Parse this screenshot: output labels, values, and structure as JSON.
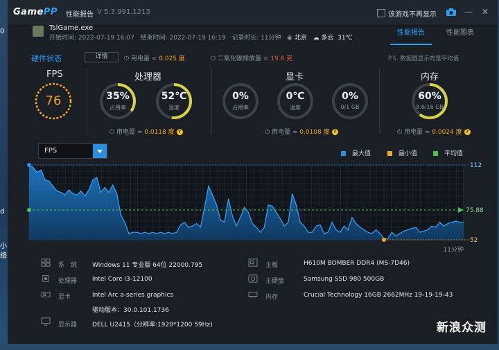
{
  "app": {
    "logo_prefix": "Game",
    "logo_suffix": "PP",
    "title": "性能报告",
    "version": "V 5.3.991.1213",
    "no_show_label": "该游戏不再显示"
  },
  "desktop": {
    "left_chars": [
      "0",
      "d",
      "小",
      "络"
    ]
  },
  "session": {
    "game": "TslGame.exe",
    "start": "开始时间: 2022-07-19 16:07",
    "end": "结束时间: 2022-07-19 16:19",
    "duration": "记录时长: 11分钟",
    "city": "北京",
    "weather": "多云",
    "temp": "31℃"
  },
  "tabs": [
    "性能报告",
    "性能图表"
  ],
  "hardware": {
    "title": "硬件状态",
    "detail_btn": "详情",
    "power_prefix": "用电量 ≈ ",
    "power_total": "0.025 度",
    "co2_prefix": "二氧化碳排放量 ≈ ",
    "co2": "19.6 克",
    "ps_note": "P.S. 数据圆显示的是平均值"
  },
  "sections": {
    "fps": {
      "title": "FPS",
      "value": "76"
    },
    "cpu": {
      "title": "处理器",
      "usage": "35%",
      "usage_label": "占用率",
      "temp": "52℃",
      "temp_label": "温度",
      "power_prefix": "用电量 ≈ ",
      "power": "0.0118 度"
    },
    "gpu": {
      "title": "显卡",
      "usage": "0%",
      "usage_label": "占用率",
      "temp": "0℃",
      "temp_label": "温度",
      "mem": "0%",
      "mem_label": "0/1 GB",
      "power_prefix": "用电量 ≈ ",
      "power": "0.0108 度"
    },
    "ram": {
      "title": "内存",
      "usage": "60%",
      "usage_label": "9.6/16 GB",
      "power_prefix": "用电量 ≈ ",
      "power": "0.0024 度"
    }
  },
  "gauge_levels": {
    "cpu_usage": 0.35,
    "cpu_temp": 0.52,
    "gpu_usage": 0,
    "gpu_temp": 0,
    "gpu_mem": 0,
    "ram_usage": 0.6
  },
  "chart_controls": {
    "metric": "FPS",
    "legend": [
      {
        "label": "最大值",
        "color": "#2a8fe0"
      },
      {
        "label": "最小值",
        "color": "#f5a623"
      },
      {
        "label": "平均值",
        "color": "#4cc24c"
      }
    ]
  },
  "chart_data": {
    "type": "area",
    "metric": "FPS",
    "xlabel": "11分钟",
    "max": 112,
    "min": 52,
    "avg": 75.88,
    "ylim": [
      52,
      112
    ],
    "labels": {
      "max": "112",
      "avg": "75.88",
      "min": "52"
    },
    "values": [
      112,
      110,
      106,
      108,
      100,
      99,
      95,
      91,
      90,
      88,
      92,
      89,
      88,
      91,
      87,
      92,
      100,
      102,
      90,
      94,
      90,
      96,
      89,
      72,
      66,
      57,
      58,
      58,
      57,
      58,
      57,
      58,
      57,
      58,
      57,
      58,
      57,
      58,
      64,
      66,
      62,
      63,
      65,
      62,
      78,
      95,
      88,
      80,
      68,
      66,
      85,
      71,
      63,
      70,
      78,
      74,
      65,
      62,
      58,
      62,
      80,
      79,
      74,
      69,
      63,
      66,
      89,
      80,
      66,
      63,
      58,
      58,
      63,
      64,
      57,
      58,
      66,
      60,
      58,
      63,
      60,
      70,
      65,
      62,
      60,
      58,
      57,
      60,
      57,
      53,
      53,
      58,
      55,
      57,
      59,
      60,
      61,
      62,
      58,
      59,
      60,
      63,
      62,
      66,
      63,
      65,
      66,
      67,
      66,
      66
    ]
  },
  "specs": [
    {
      "label": "系　统",
      "value": "Windows 11 专业版 64位   22000.795",
      "icon": "os-icon"
    },
    {
      "label": "处理器",
      "value": "Intel Core i3-12100",
      "icon": "cpu-icon"
    },
    {
      "label": "显卡",
      "value": "Intel Arc a-series graphics",
      "value2": "驱动版本：30.0.101.1736",
      "icon": "gpu-icon"
    },
    {
      "label": "显示器",
      "value": "DELL U2415（分辨率:1920*1200 59Hz)",
      "icon": "monitor-icon"
    },
    {
      "label": "主板",
      "value": "H610M BOMBER DDR4 (MS-7D46)",
      "icon": "board-icon"
    },
    {
      "label": "主硬盘",
      "value": "Samsung SSD 980 500GB",
      "icon": "disk-icon"
    },
    {
      "label": "内存",
      "value": "Crucial Technology 16GB 2662MHz 19-19-19-43",
      "icon": "ram-icon"
    }
  ],
  "watermark": "新浪众测"
}
